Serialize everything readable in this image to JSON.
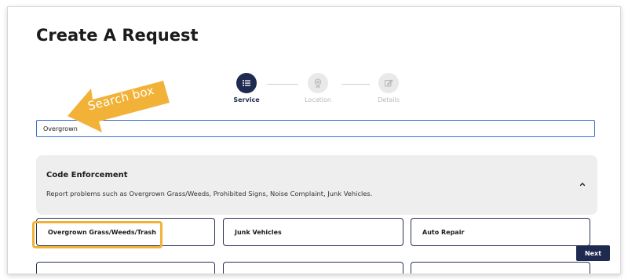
{
  "page": {
    "title": "Create A Request"
  },
  "stepper": {
    "steps": [
      {
        "label": "Service",
        "icon": "list-icon",
        "state": "active"
      },
      {
        "label": "Location",
        "icon": "location-pin-icon",
        "state": "inactive"
      },
      {
        "label": "Details",
        "icon": "edit-icon",
        "state": "inactive"
      }
    ]
  },
  "search": {
    "value": "Overgrown",
    "placeholder": ""
  },
  "annotation": {
    "text": "Search box",
    "color": "#f1b237"
  },
  "category": {
    "title": "Code Enforcement",
    "description": "Report problems such as Overgrown Grass/Weeds, Prohibited Signs, Noise Complaint, Junk Vehicles.",
    "expanded": true,
    "chevron_icon": "chevron-up-icon"
  },
  "services": [
    {
      "label": "Overgrown Grass/Weeds/Trash",
      "highlighted": true
    },
    {
      "label": "Junk Vehicles",
      "highlighted": false
    },
    {
      "label": "Auto Repair",
      "highlighted": false
    }
  ],
  "actions": {
    "next_label": "Next"
  },
  "colors": {
    "primary": "#1f2a50",
    "input_border": "#3a6fd0",
    "highlight": "#f1b237",
    "panel_bg": "#eeeeee"
  }
}
